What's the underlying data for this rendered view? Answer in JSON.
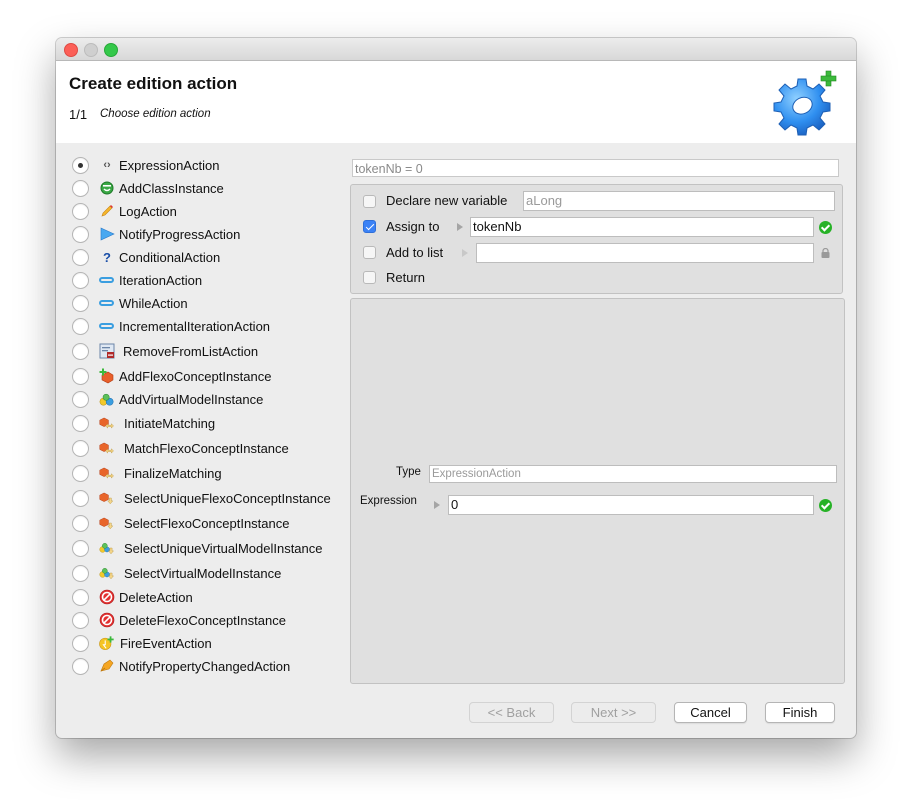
{
  "window": {
    "traffic_lights": [
      "close",
      "minimize",
      "maximize"
    ]
  },
  "header": {
    "title": "Create edition action",
    "step": "1/1",
    "step_description": "Choose edition action",
    "logo_icon": "gear-add-icon"
  },
  "actions": {
    "selected_index": 0,
    "items": [
      {
        "label": "ExpressionAction",
        "icon": "expression-icon",
        "selected": true
      },
      {
        "label": "AddClassInstance",
        "icon": "add-class-instance-icon",
        "selected": false
      },
      {
        "label": "LogAction",
        "icon": "pencil-icon",
        "selected": false
      },
      {
        "label": "NotifyProgressAction",
        "icon": "play-arrow-icon",
        "selected": false
      },
      {
        "label": "ConditionalAction",
        "icon": "question-mark-icon",
        "selected": false
      },
      {
        "label": "IterationAction",
        "icon": "loop-icon",
        "selected": false
      },
      {
        "label": "WhileAction",
        "icon": "loop-icon",
        "selected": false
      },
      {
        "label": "IncrementalIterationAction",
        "icon": "loop-icon",
        "selected": false
      },
      {
        "label": "RemoveFromListAction",
        "icon": "remove-from-list-icon",
        "selected": false
      },
      {
        "label": "AddFlexoConceptInstance",
        "icon": "add-flexo-concept-icon",
        "selected": false
      },
      {
        "label": "AddVirtualModelInstance",
        "icon": "add-virtual-model-icon",
        "selected": false
      },
      {
        "label": "InitiateMatching",
        "icon": "matching-icon",
        "selected": false
      },
      {
        "label": "MatchFlexoConceptInstance",
        "icon": "matching-icon",
        "selected": false
      },
      {
        "label": "FinalizeMatching",
        "icon": "matching-icon",
        "selected": false
      },
      {
        "label": "SelectUniqueFlexoConceptInstance",
        "icon": "select-flexo-concept-icon",
        "selected": false
      },
      {
        "label": "SelectFlexoConceptInstance",
        "icon": "select-flexo-concept-icon",
        "selected": false
      },
      {
        "label": "SelectUniqueVirtualModelInstance",
        "icon": "select-virtual-model-icon",
        "selected": false
      },
      {
        "label": "SelectVirtualModelInstance",
        "icon": "select-virtual-model-icon",
        "selected": false
      },
      {
        "label": "DeleteAction",
        "icon": "delete-icon",
        "selected": false
      },
      {
        "label": "DeleteFlexoConceptInstance",
        "icon": "delete-icon",
        "selected": false
      },
      {
        "label": "FireEventAction",
        "icon": "fire-event-icon",
        "selected": false
      },
      {
        "label": "NotifyPropertyChangedAction",
        "icon": "notify-property-icon",
        "selected": false
      }
    ]
  },
  "details": {
    "summary": "tokenNb = 0",
    "declare_new_variable": {
      "label": "Declare new variable",
      "checked": false,
      "value": "aLong"
    },
    "assign_to": {
      "label": "Assign to",
      "checked": true,
      "value": "tokenNb",
      "status": "valid"
    },
    "add_to_list": {
      "label": "Add to list",
      "checked": false,
      "value": "",
      "status": "locked"
    },
    "return": {
      "label": "Return",
      "checked": false
    },
    "type": {
      "label": "Type",
      "value": "ExpressionAction"
    },
    "expression": {
      "label": "Expression",
      "value": "0",
      "status": "valid"
    }
  },
  "buttons": {
    "back": "<< Back",
    "next": "Next >>",
    "cancel": "Cancel",
    "finish": "Finish"
  }
}
